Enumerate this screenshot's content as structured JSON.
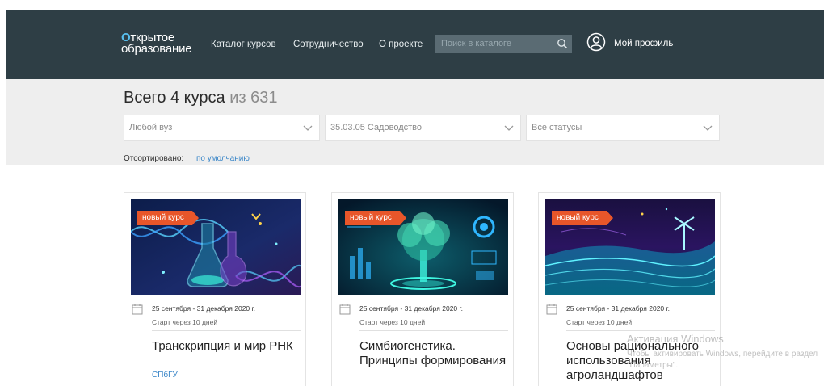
{
  "header": {
    "logo_line1": "ткрытое",
    "logo_mark": "О",
    "logo_line2": "образование",
    "nav": [
      "Каталог курсов",
      "Сотрудничество",
      "О проекте"
    ],
    "search_placeholder": "Поиск в каталоге",
    "profile_label": "Мой профиль"
  },
  "filters": {
    "title_prefix": "Всего 4 курса",
    "title_total": "из 631",
    "university": "Любой вуз",
    "direction": "35.03.05 Садоводство",
    "status": "Все статусы",
    "sort_label": "Отсортировано:",
    "sort_value": "по умолчанию"
  },
  "cards": [
    {
      "badge": "новый курс",
      "dates": "25 сентября - 31 декабря 2020 г.",
      "start": "Старт через 10 дней",
      "title": "Транскрипция и мир РНК",
      "university": "СПбГУ",
      "image": "dna-flasks"
    },
    {
      "badge": "новый курс",
      "dates": "25 сентября - 31 декабря 2020 г.",
      "start": "Старт через 10 дней",
      "title": "Симбиогенетика. Принципы формирования",
      "university": "",
      "image": "holographic-tree"
    },
    {
      "badge": "новый курс",
      "dates": "25 сентября - 31 декабря 2020 г.",
      "start": "Старт через 10 дней",
      "title": "Основы рационального использования агроландшафтов",
      "university": "",
      "image": "digital-field"
    }
  ],
  "watermark": {
    "line1": "Активация Windows",
    "line2": "Чтобы активировать Windows, перейдите в раздел \"Параметры\"."
  },
  "colors": {
    "header_bg": "#2e3e45",
    "band_bg": "#eeeeee",
    "badge": "#e8562a",
    "link": "#3a86c8",
    "logo_accent": "#58c0f0"
  }
}
